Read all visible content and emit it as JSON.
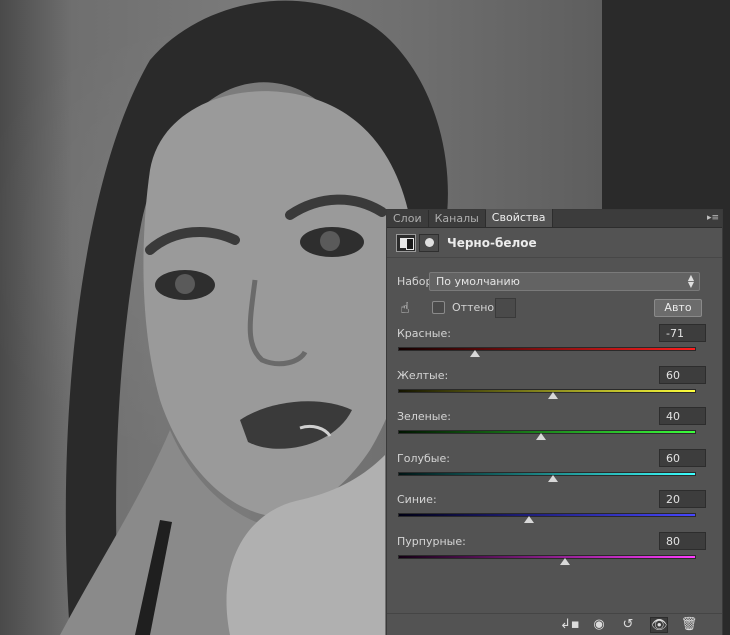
{
  "panel": {
    "tabs": [
      {
        "label": "Слои",
        "active": false
      },
      {
        "label": "Каналы",
        "active": false
      },
      {
        "label": "Свойства",
        "active": true
      }
    ],
    "menu_icon": "panel-menu-icon",
    "title": "Черно-белое",
    "preset": {
      "label": "Набор:",
      "value": "По умолчанию"
    },
    "tint": {
      "label": "Оттенок",
      "checked": false
    },
    "auto_label": "Авто",
    "sliders": [
      {
        "label": "Красные:",
        "value": "-71",
        "fraction": 0.26,
        "gradient": [
          "#140000",
          "#ff1e1e"
        ]
      },
      {
        "label": "Желтые:",
        "value": "60",
        "fraction": 0.52,
        "gradient": [
          "#141400",
          "#ffff3c"
        ]
      },
      {
        "label": "Зеленые:",
        "value": "40",
        "fraction": 0.48,
        "gradient": [
          "#001400",
          "#3cff3c"
        ]
      },
      {
        "label": "Голубые:",
        "value": "60",
        "fraction": 0.52,
        "gradient": [
          "#001414",
          "#3cffff"
        ]
      },
      {
        "label": "Синие:",
        "value": "20",
        "fraction": 0.44,
        "gradient": [
          "#000014",
          "#4646ff"
        ]
      },
      {
        "label": "Пурпурные:",
        "value": "80",
        "fraction": 0.56,
        "gradient": [
          "#140014",
          "#ff3cff"
        ]
      }
    ],
    "bottom_icons": [
      "clip-to-layer-icon",
      "view-previous-state-icon",
      "reset-icon",
      "toggle-visibility-icon",
      "delete-icon"
    ]
  },
  "colors": {
    "panel_bg": "#535353",
    "tab_bar_bg": "#3c3c3c",
    "dark_side": "#2a2a2a"
  }
}
